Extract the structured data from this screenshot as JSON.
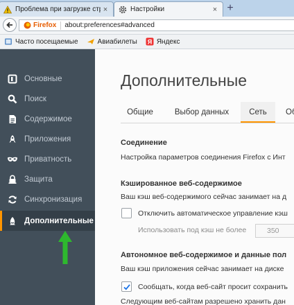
{
  "browser": {
    "tabs": [
      {
        "label": "Проблема при загрузке стр",
        "active": false,
        "icon": "warning-icon"
      },
      {
        "label": "Настройки",
        "active": true,
        "icon": "gear-icon"
      }
    ],
    "new_tab": "+",
    "close_glyph": "×",
    "identity_label": "Firefox",
    "url": "about:preferences#advanced"
  },
  "bookmarks": [
    {
      "label": "Часто посещаемые",
      "icon": "bookmark-folder-icon"
    },
    {
      "label": "Авиабилеты",
      "icon": "airplane-icon"
    },
    {
      "label": "Яндекс",
      "icon": "yandex-icon"
    }
  ],
  "sidebar": {
    "items": [
      {
        "label": "Основные",
        "icon": "general-icon",
        "active": false
      },
      {
        "label": "Поиск",
        "icon": "search-icon",
        "active": false
      },
      {
        "label": "Содержимое",
        "icon": "content-icon",
        "active": false
      },
      {
        "label": "Приложения",
        "icon": "applications-icon",
        "active": false
      },
      {
        "label": "Приватность",
        "icon": "privacy-mask-icon",
        "active": false
      },
      {
        "label": "Защита",
        "icon": "security-lock-icon",
        "active": false
      },
      {
        "label": "Синхронизация",
        "icon": "sync-icon",
        "active": false
      },
      {
        "label": "Дополнительные",
        "icon": "advanced-icon",
        "active": true
      }
    ]
  },
  "main": {
    "title": "Дополнительные",
    "tabs": [
      {
        "label": "Общие",
        "selected": false
      },
      {
        "label": "Выбор данных",
        "selected": false
      },
      {
        "label": "Сеть",
        "selected": true
      },
      {
        "label": "Об",
        "selected": false
      }
    ],
    "connection": {
      "heading": "Соединение",
      "description": "Настройка параметров соединения Firefox с Инт"
    },
    "cache": {
      "heading": "Кэшированное веб-содержимое",
      "description": "Ваш кэш веб-содержимого сейчас занимает на д",
      "override_label": "Отключить автоматическое управление кэш",
      "override_checked": false,
      "limit_label": "Использовать под кэш не более",
      "limit_value": "350"
    },
    "offline": {
      "heading": "Автономное веб-содержимое и данные пол",
      "description": "Ваш кэш приложения сейчас занимает на диске",
      "notify_label": "Сообщать, когда веб-сайт просит сохранить",
      "notify_checked": true,
      "allowed_text": "Следующим веб-сайтам разрешено хранить дан"
    }
  },
  "colors": {
    "sidebar_bg": "#424f5a",
    "accent": "#ff9500",
    "arrow": "#2eb82e"
  }
}
